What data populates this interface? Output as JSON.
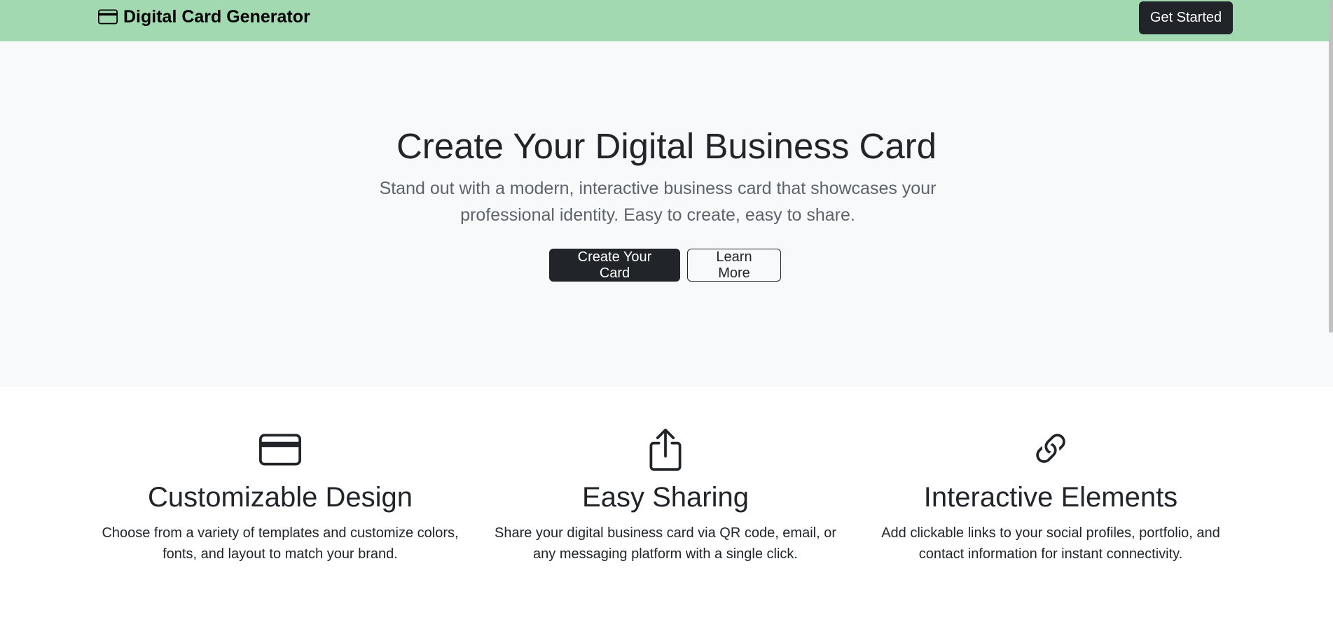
{
  "navbar": {
    "brand_icon": "credit-card-icon",
    "brand_text": "Digital Card Generator",
    "cta_label": "Get Started",
    "background": "#a3d9b1"
  },
  "hero": {
    "title": "Create Your Digital Business Card",
    "subtitle": "Stand out with a modern, interactive business card that showcases your professional identity. Easy to create, easy to share.",
    "primary_button": "Create Your Card",
    "secondary_button": "Learn More",
    "background": "#f8f9fa"
  },
  "features": [
    {
      "icon": "credit-card-icon",
      "title": "Customizable Design",
      "description": "Choose from a variety of templates and customize colors, fonts, and layout to match your brand."
    },
    {
      "icon": "share-icon",
      "title": "Easy Sharing",
      "description": "Share your digital business card via QR code, email, or any messaging platform with a single click."
    },
    {
      "icon": "link-icon",
      "title": "Interactive Elements",
      "description": "Add clickable links to your social profiles, portfolio, and contact information for instant connectivity."
    }
  ],
  "colors": {
    "dark": "#212529",
    "muted": "#5c636a"
  }
}
